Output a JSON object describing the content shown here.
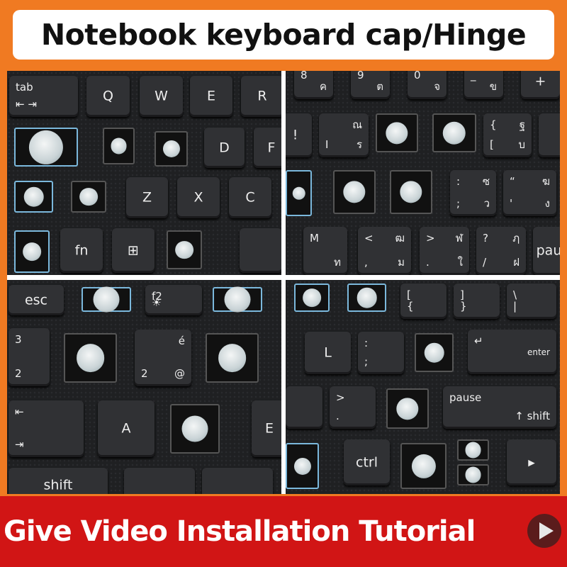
{
  "header": {
    "title": "Notebook keyboard cap/Hinge"
  },
  "footer": {
    "text": "Give Video Installation Tutorial",
    "icon": "play-icon"
  },
  "colors": {
    "banner_orange": "#f07a22",
    "footer_red": "#d11515",
    "keyboard": "#1f2022"
  },
  "quadrants": [
    {
      "name": "top-left",
      "keys": [
        {
          "kind": "key",
          "labels": [
            "tab",
            "⇤ ⇥"
          ]
        },
        {
          "kind": "key",
          "labels": [
            "Q"
          ]
        },
        {
          "kind": "key",
          "labels": [
            "W"
          ]
        },
        {
          "kind": "key",
          "labels": [
            "E"
          ]
        },
        {
          "kind": "key",
          "labels": [
            "R"
          ]
        },
        {
          "kind": "hinge"
        },
        {
          "kind": "hinge"
        },
        {
          "kind": "hinge"
        },
        {
          "kind": "key",
          "labels": [
            "D"
          ]
        },
        {
          "kind": "key",
          "labels": [
            "F"
          ]
        },
        {
          "kind": "hinge"
        },
        {
          "kind": "hinge"
        },
        {
          "kind": "key",
          "labels": [
            "Z"
          ]
        },
        {
          "kind": "key",
          "labels": [
            "X"
          ]
        },
        {
          "kind": "key",
          "labels": [
            "C"
          ]
        },
        {
          "kind": "hinge"
        },
        {
          "kind": "key",
          "labels": [
            "fn"
          ]
        },
        {
          "kind": "key",
          "labels": [
            "⊞"
          ]
        },
        {
          "kind": "hinge"
        },
        {
          "kind": "key",
          "labels": []
        }
      ]
    },
    {
      "name": "top-right",
      "keys": [
        {
          "kind": "key",
          "labels": [
            "8",
            "ค"
          ]
        },
        {
          "kind": "key",
          "labels": [
            "9",
            "ต"
          ]
        },
        {
          "kind": "key",
          "labels": [
            "0",
            "จ"
          ]
        },
        {
          "kind": "key",
          "labels": [
            "_",
            "ข"
          ]
        },
        {
          "kind": "key",
          "labels": [
            "+"
          ]
        },
        {
          "kind": "key",
          "labels": [
            "!"
          ]
        },
        {
          "kind": "key",
          "labels": [
            "I",
            "ณ",
            "ร"
          ]
        },
        {
          "kind": "hinge"
        },
        {
          "kind": "hinge"
        },
        {
          "kind": "key",
          "labels": [
            "{",
            "ฐ",
            "[",
            "บ"
          ]
        },
        {
          "kind": "key",
          "labels": []
        },
        {
          "kind": "hinge"
        },
        {
          "kind": "hinge"
        },
        {
          "kind": "hinge"
        },
        {
          "kind": "key",
          "labels": [
            ":",
            "ซ",
            ";",
            "ว"
          ]
        },
        {
          "kind": "key",
          "labels": [
            "“",
            "ฆ",
            "'",
            "ง"
          ]
        },
        {
          "kind": "key",
          "labels": [
            "M",
            "ท"
          ]
        },
        {
          "kind": "key",
          "labels": [
            "<",
            "ฒ",
            ",",
            "ม"
          ]
        },
        {
          "kind": "key",
          "labels": [
            ">",
            "ฬ",
            ".",
            "ใ"
          ]
        },
        {
          "kind": "key",
          "labels": [
            "?",
            "ฦ",
            "/",
            "ฝ"
          ]
        },
        {
          "kind": "key",
          "labels": [
            "pau"
          ]
        }
      ]
    },
    {
      "name": "bottom-left",
      "keys": [
        {
          "kind": "key",
          "labels": [
            "esc"
          ]
        },
        {
          "kind": "hinge"
        },
        {
          "kind": "key",
          "labels": [
            "f2",
            "☀"
          ]
        },
        {
          "kind": "hinge"
        },
        {
          "kind": "key",
          "labels": [
            "3",
            "2"
          ]
        },
        {
          "kind": "hinge"
        },
        {
          "kind": "key",
          "labels": [
            "2",
            "é",
            "@"
          ]
        },
        {
          "kind": "hinge"
        },
        {
          "kind": "key",
          "labels": [
            "⇤",
            "⇥"
          ]
        },
        {
          "kind": "key",
          "labels": [
            "A"
          ]
        },
        {
          "kind": "hinge"
        },
        {
          "kind": "key",
          "labels": [
            "E"
          ]
        },
        {
          "kind": "key",
          "labels": [
            "shift"
          ]
        },
        {
          "kind": "key",
          "labels": []
        },
        {
          "kind": "key",
          "labels": []
        }
      ]
    },
    {
      "name": "bottom-right",
      "keys": [
        {
          "kind": "hinge"
        },
        {
          "kind": "hinge"
        },
        {
          "kind": "key",
          "labels": [
            "[",
            "{"
          ]
        },
        {
          "kind": "key",
          "labels": [
            "]",
            "}"
          ]
        },
        {
          "kind": "key",
          "labels": [
            "\\",
            "|"
          ]
        },
        {
          "kind": "key",
          "labels": [
            "L"
          ]
        },
        {
          "kind": "key",
          "labels": [
            ":",
            ";"
          ]
        },
        {
          "kind": "hinge"
        },
        {
          "kind": "key",
          "labels": [
            "↵",
            "enter"
          ]
        },
        {
          "kind": "key",
          "labels": []
        },
        {
          "kind": "key",
          "labels": [
            ">",
            "."
          ]
        },
        {
          "kind": "hinge"
        },
        {
          "kind": "key",
          "labels": [
            "pause",
            "↑ shift"
          ]
        },
        {
          "kind": "hinge"
        },
        {
          "kind": "key",
          "labels": [
            "ctrl"
          ]
        },
        {
          "kind": "hinge"
        },
        {
          "kind": "hinge"
        },
        {
          "kind": "hinge"
        },
        {
          "kind": "key",
          "labels": [
            "▸"
          ]
        }
      ]
    }
  ]
}
